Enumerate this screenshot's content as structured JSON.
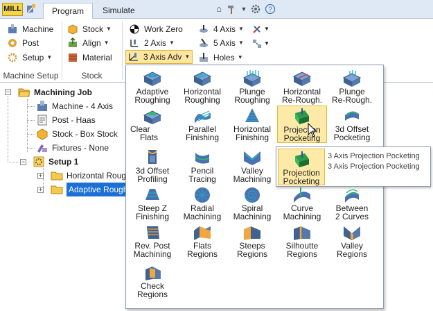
{
  "app": {
    "mill_button": "MILL",
    "tabs": [
      "Program",
      "Simulate"
    ],
    "active_tab": "Program",
    "right_icons": [
      "collapse-ribbon-icon",
      "hammer-icon",
      "dropdown-icon",
      "settings-gear-icon",
      "help-icon"
    ]
  },
  "ribbon": {
    "machine_setup": {
      "label": "Machine Setup",
      "buttons": [
        {
          "label": "Machine",
          "icon": "machine-icon"
        },
        {
          "label": "Post",
          "icon": "post-icon"
        },
        {
          "label": "Setup",
          "icon": "setup-icon",
          "has_dropdown": true
        }
      ]
    },
    "stock": {
      "label": "Stock",
      "buttons": [
        {
          "label": "Stock",
          "icon": "stock-box-icon",
          "has_dropdown": true
        },
        {
          "label": "Align",
          "icon": "align-icon",
          "has_dropdown": true
        },
        {
          "label": "Material",
          "icon": "material-icon"
        }
      ]
    },
    "toolpaths": {
      "buttons": [
        {
          "label": "Work Zero",
          "icon": "work-zero-icon"
        },
        {
          "label": "2 Axis",
          "icon": "2-axis-icon",
          "has_dropdown": true
        },
        {
          "label": "3 Axis Adv",
          "icon": "3-axis-adv-icon",
          "has_dropdown": true,
          "pressed": true
        },
        {
          "label": "4 Axis",
          "icon": "4-axis-icon",
          "has_dropdown": true
        },
        {
          "label": "5 Axis",
          "icon": "5-axis-icon",
          "has_dropdown": true
        },
        {
          "label": "Holes",
          "icon": "holes-icon",
          "has_dropdown": true
        }
      ]
    }
  },
  "tree": {
    "root": "Machining Job",
    "items": [
      {
        "label": "Machine - 4 Axis",
        "icon": "machine-icon"
      },
      {
        "label": "Post - Haas",
        "icon": "post-icon"
      },
      {
        "label": "Stock - Box Stock",
        "icon": "stock-box-icon"
      },
      {
        "label": "Fixtures - None",
        "icon": "fixtures-icon"
      }
    ],
    "setup": "Setup 1",
    "setup_children": [
      {
        "label": "Horizontal Roug",
        "icon": "folder-icon"
      },
      {
        "label": "Adaptive Rough",
        "icon": "folder-icon",
        "selected": true
      }
    ]
  },
  "menu": {
    "items": [
      {
        "line1": "Adaptive",
        "line2": "Roughing",
        "icon": "adaptive-roughing-icon"
      },
      {
        "line1": "Horizontal",
        "line2": "Roughing",
        "icon": "horizontal-roughing-icon"
      },
      {
        "line1": "Plunge",
        "line2": "Roughing",
        "icon": "plunge-roughing-icon"
      },
      {
        "line1": "Horizontal",
        "line2": "Re-Rough.",
        "icon": "horizontal-rerough-icon"
      },
      {
        "line1": "Plunge",
        "line2": "Re-Rough.",
        "icon": "plunge-rerough-icon"
      },
      {
        "line1": "Clear",
        "line2": "Flats",
        "icon": "clear-flats-icon"
      },
      {
        "line1": "Parallel",
        "line2": "Finishing",
        "icon": "parallel-finishing-icon"
      },
      {
        "line1": "Horizontal",
        "line2": "Finishing",
        "icon": "horizontal-finishing-icon"
      },
      {
        "line1": "Projection",
        "line2": "Pocketing",
        "icon": "projection-pocketing-icon",
        "hovered": true
      },
      {
        "line1": "3d Offset",
        "line2": "Pocketing",
        "icon": "3d-offset-pocketing-icon"
      },
      {
        "line1": "3d Offset",
        "line2": "Profiling",
        "icon": "3d-offset-profiling-icon"
      },
      {
        "line1": "Pencil",
        "line2": "Tracing",
        "icon": "pencil-tracing-icon"
      },
      {
        "line1": "Valley",
        "line2": "Machining",
        "icon": "valley-machining-icon"
      },
      {
        "line1": "Steep Z",
        "line2": "Finishing",
        "icon": "steep-z-finishing-icon"
      },
      {
        "line1": "Radial",
        "line2": "Machining",
        "icon": "radial-machining-icon"
      },
      {
        "line1": "Spiral",
        "line2": "Machining",
        "icon": "spiral-machining-icon"
      },
      {
        "line1": "Curve",
        "line2": "Machining",
        "icon": "curve-machining-icon"
      },
      {
        "line1": "Between",
        "line2": "2 Curves",
        "icon": "between-2-curves-icon"
      },
      {
        "line1": "Rev. Post",
        "line2": "Machining",
        "icon": "rev-post-machining-icon"
      },
      {
        "line1": "Flats",
        "line2": "Regions",
        "icon": "flats-regions-icon"
      },
      {
        "line1": "Steeps",
        "line2": "Regions",
        "icon": "steeps-regions-icon"
      },
      {
        "line1": "Silhoutte",
        "line2": "Regions",
        "icon": "silhouette-regions-icon"
      },
      {
        "line1": "Valley",
        "line2": "Regions",
        "icon": "valley-regions-icon"
      },
      {
        "line1": "Check",
        "line2": "Regions",
        "icon": "check-regions-icon"
      }
    ]
  },
  "tooltip": {
    "title": "3 Axis Projection Pocketing",
    "description": "3 Axis Projection Pocketing",
    "line1": "Projection",
    "line2": "Pocketing"
  },
  "colors": {
    "accent_blue": "#1b6fd6",
    "hover_yellow": "#fde9a8",
    "mill_yellow": "#f4d54a"
  }
}
